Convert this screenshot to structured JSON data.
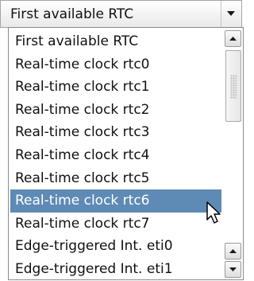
{
  "combo": {
    "value": "First available RTC",
    "arrow_icon": "triangle-down-icon"
  },
  "dropdown": {
    "items": [
      {
        "label": "First available RTC"
      },
      {
        "label": "Real-time clock rtc0"
      },
      {
        "label": "Real-time clock rtc1"
      },
      {
        "label": "Real-time clock rtc2"
      },
      {
        "label": "Real-time clock rtc3"
      },
      {
        "label": "Real-time clock rtc4"
      },
      {
        "label": "Real-time clock rtc5"
      },
      {
        "label": "Real-time clock rtc6"
      },
      {
        "label": "Real-time clock rtc7"
      },
      {
        "label": "Edge-triggered Int. eti0"
      },
      {
        "label": "Edge-triggered Int. eti1"
      }
    ],
    "highlighted_item": "Real-time clock rtc6",
    "selection_color": "#5e8ab6"
  },
  "scrollbar": {
    "up_icon": "triangle-up-icon",
    "down_icon": "triangle-down-icon"
  },
  "cursor_icon": "arrow-pointer-icon"
}
